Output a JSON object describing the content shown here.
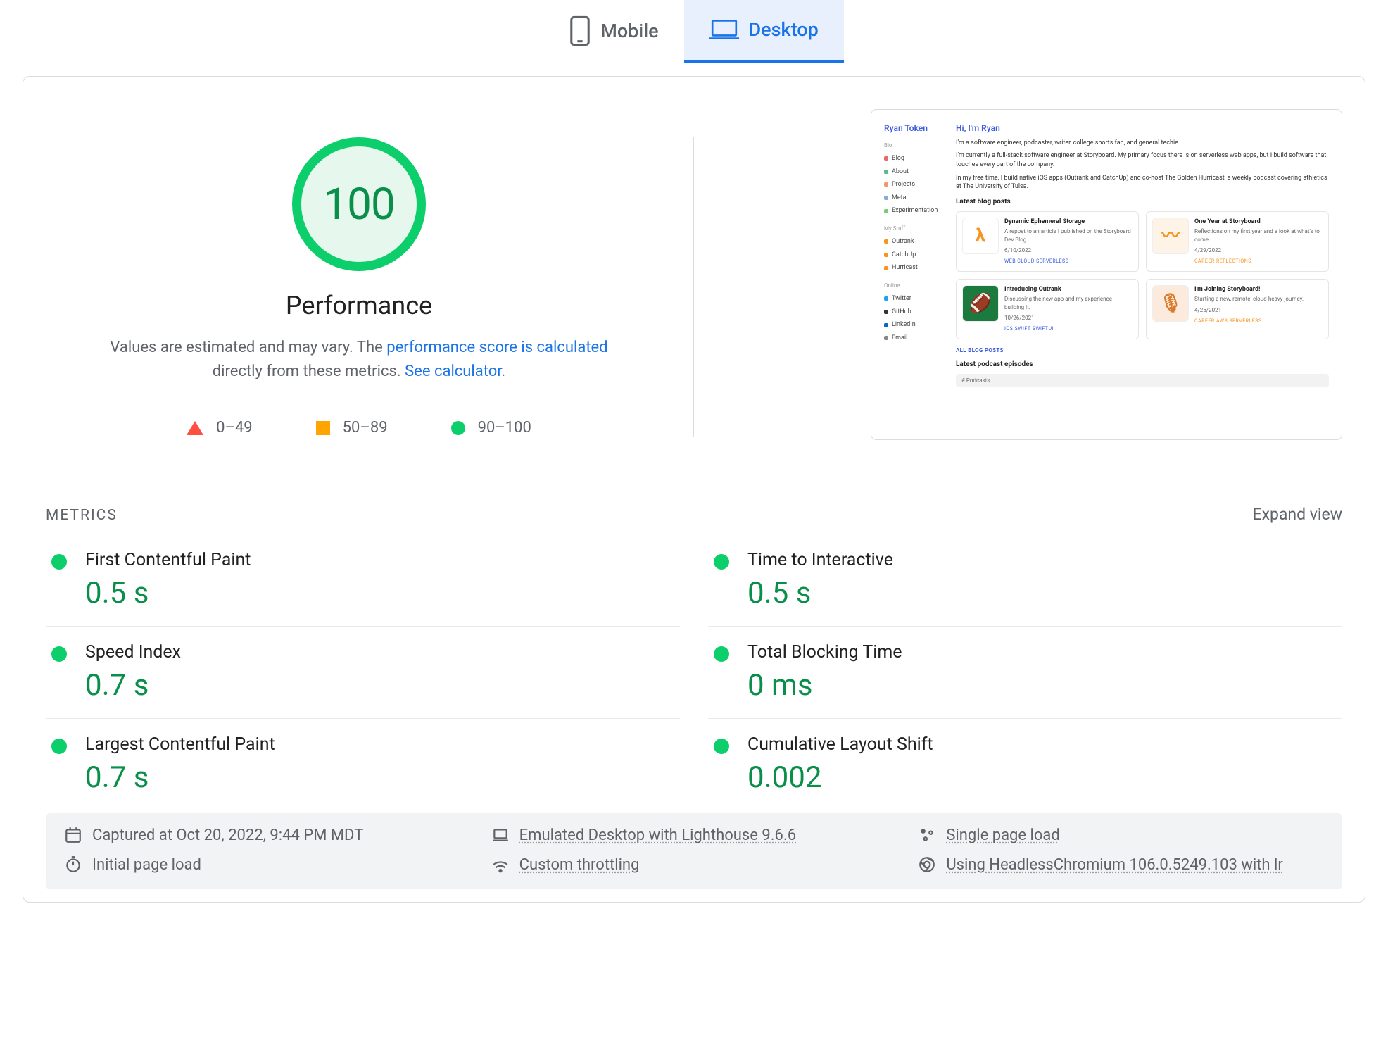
{
  "tabs": {
    "mobile_label": "Mobile",
    "desktop_label": "Desktop"
  },
  "score": {
    "value": "100",
    "title": "Performance",
    "desc_pre": "Values are estimated and may vary. The ",
    "desc_link1": "performance score is calculated",
    "desc_mid": " directly from these metrics. ",
    "desc_link2": "See calculator."
  },
  "legend": {
    "r1": "0–49",
    "r2": "50–89",
    "r3": "90–100"
  },
  "preview": {
    "side_title": "Ryan Token",
    "sec_bio": "Bio",
    "items_bio": [
      "Blog",
      "About",
      "Projects",
      "Meta",
      "Experimentation"
    ],
    "sec_stuff": "My Stuff",
    "items_stuff": [
      "Outrank",
      "CatchUp",
      "Hurricast"
    ],
    "sec_online": "Online",
    "items_online": [
      "Twitter",
      "GitHub",
      "LinkedIn",
      "Email"
    ],
    "main_title": "Hi, I'm Ryan",
    "p1": "I'm a software engineer, podcaster, writer, college sports fan, and general techie.",
    "p2": "I'm currently a full-stack software engineer at Storyboard. My primary focus there is on serverless web apps, but I build software that touches every part of the company.",
    "p3": "In my free time, I build native iOS apps (Outrank and CatchUp) and co-host The Golden Hurricast, a weekly podcast covering athletics at The University of Tulsa.",
    "latest_posts": "Latest blog posts",
    "cards": [
      {
        "title": "Dynamic Ephemeral Storage",
        "sub": "A repost to an article I published on the Storyboard Dev Blog.",
        "date": "6/10/2022",
        "tags": "WEB   CLOUD   SERVERLESS",
        "thumb_bg": "#fff",
        "thumb_txt": "λ",
        "thumb_color": "#f7931e",
        "tag_color": "#3b5bdb"
      },
      {
        "title": "One Year at Storyboard",
        "sub": "Reflections on my first year and a look at what's to come.",
        "date": "4/29/2022",
        "tags": "CAREER   REFLECTIONS",
        "thumb_bg": "#fdf3e7",
        "thumb_txt": "〰",
        "thumb_color": "#f7931e",
        "tag_color": "#f7931e"
      },
      {
        "title": "Introducing Outrank",
        "sub": "Discussing the new app and my experience building it.",
        "date": "10/26/2021",
        "tags": "IOS   SWIFT   SWIFTUI",
        "thumb_bg": "#1b7a3d",
        "thumb_txt": "🏈",
        "thumb_color": "#fff",
        "tag_color": "#3b5bdb"
      },
      {
        "title": "I'm Joining Storyboard!",
        "sub": "Starting a new, remote, cloud-heavy journey.",
        "date": "4/25/2021",
        "tags": "CAREER   AWS   SERVERLESS",
        "thumb_bg": "#fcebdc",
        "thumb_txt": "🎙",
        "thumb_color": "#d97b29",
        "tag_color": "#f7931e"
      }
    ],
    "all_posts": "ALL BLOG POSTS",
    "latest_episodes": "Latest podcast episodes",
    "tabbar": "# Podcasts"
  },
  "metrics_header": "METRICS",
  "expand": "Expand view",
  "metrics": [
    {
      "label": "First Contentful Paint",
      "value": "0.5 s"
    },
    {
      "label": "Time to Interactive",
      "value": "0.5 s"
    },
    {
      "label": "Speed Index",
      "value": "0.7 s"
    },
    {
      "label": "Total Blocking Time",
      "value": "0 ms"
    },
    {
      "label": "Largest Contentful Paint",
      "value": "0.7 s"
    },
    {
      "label": "Cumulative Layout Shift",
      "value": "0.002"
    }
  ],
  "footer": {
    "captured": "Captured at Oct 20, 2022, 9:44 PM MDT",
    "emulated": "Emulated Desktop with Lighthouse 9.6.6",
    "single": "Single page load",
    "initial": "Initial page load",
    "throttling": "Custom throttling",
    "browser": "Using HeadlessChromium 106.0.5249.103 with lr"
  }
}
